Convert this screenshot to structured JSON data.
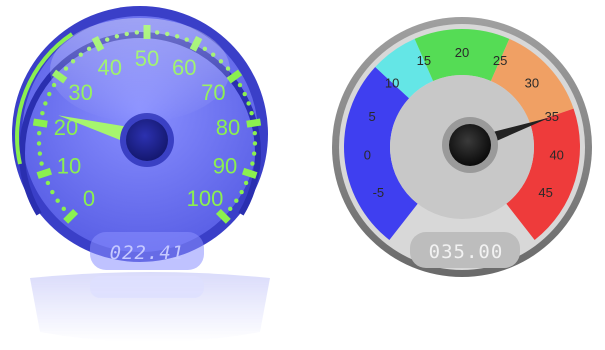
{
  "gauges": [
    {
      "name": "speedometer-gauge",
      "min": 0,
      "max": 100,
      "tick_labels": [
        "0",
        "10",
        "20",
        "30",
        "40",
        "50",
        "60",
        "70",
        "80",
        "90",
        "100"
      ],
      "needle_value": 22.41,
      "lcd_text": "022.41",
      "colors": {
        "face": "#6c72ee",
        "rim": "#3a3fc8",
        "tick": "#8bf04f",
        "needle": "#a6f56e",
        "hub": "#1e2290"
      }
    },
    {
      "name": "temperature-gauge",
      "min": -10,
      "max": 50,
      "tick_labels": [
        "-5",
        "0",
        "5",
        "10",
        "15",
        "20",
        "25",
        "30",
        "35",
        "40",
        "45"
      ],
      "needle_value": 35,
      "lcd_text": "035.00",
      "zones": [
        {
          "from": -10,
          "to": 10,
          "color": "#3f3ff0"
        },
        {
          "from": 10,
          "to": 15,
          "color": "#64e6e6"
        },
        {
          "from": 15,
          "to": 25,
          "color": "#55dc55"
        },
        {
          "from": 25,
          "to": 35,
          "color": "#f0a064"
        },
        {
          "from": 35,
          "to": 50,
          "color": "#ee3b3b"
        }
      ],
      "colors": {
        "rim": "#8a8a8a",
        "inner": "#c8c8c8",
        "needle": "#222222",
        "hub": "#1a1a1a"
      }
    }
  ]
}
